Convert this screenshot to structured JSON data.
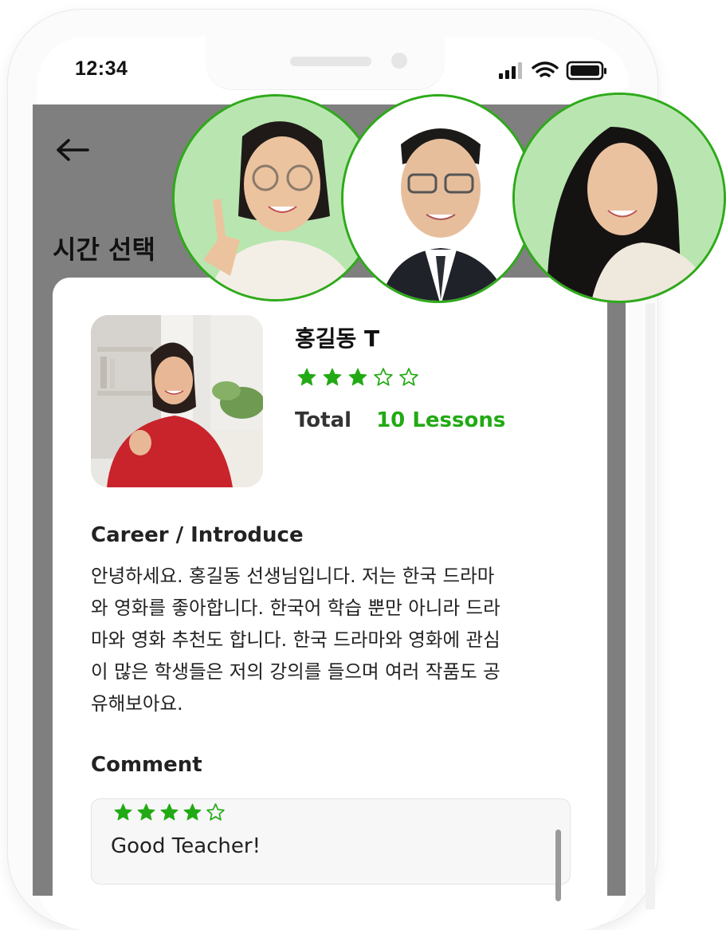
{
  "status_bar": {
    "time": "12:34"
  },
  "header": {
    "title": "시간 선택",
    "back_icon": "arrow-left-icon"
  },
  "teacher": {
    "name": "홍길동 T",
    "rating": 3,
    "rating_max": 5,
    "total_label": "Total",
    "total_value": "10 Lessons"
  },
  "career": {
    "title": "Career / Introduce",
    "lines": [
      "안녕하세요. 홍길동 선생님입니다. 저는 한국 드라마",
      "와 영화를 좋아합니다. 한국어 학습 뿐만 아니라 드라",
      "마와 영화 추천도 합니다. 한국 드라마와 영화에 관심",
      "이 많은 학생들은 저의 강의를 들으며 여러 작품도 공",
      "유해보아요."
    ]
  },
  "comments": {
    "title": "Comment",
    "items": [
      {
        "rating": 4,
        "rating_max": 5,
        "text": "Good Teacher!"
      }
    ]
  },
  "colors": {
    "accent": "#22aa14",
    "app_background": "#7f7f7f",
    "avatar_bg": "#b9e6b0",
    "avatar_border": "#2eaa1a"
  }
}
